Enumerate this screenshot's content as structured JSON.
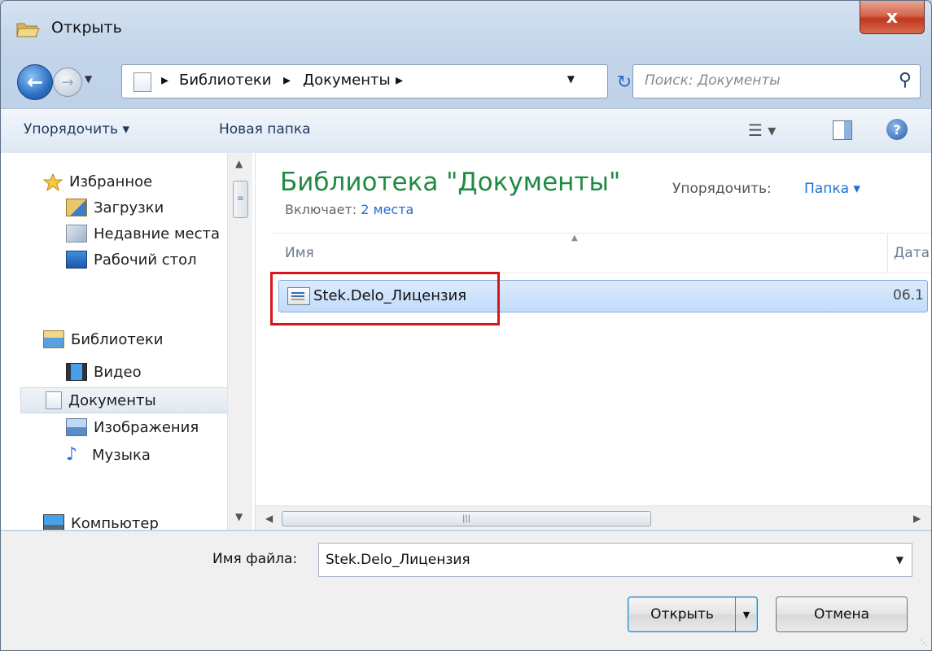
{
  "window": {
    "title": "Открыть",
    "close_label": "x"
  },
  "nav": {
    "breadcrumbs": [
      "Библиотеки",
      "Документы"
    ],
    "search_placeholder": "Поиск: Документы"
  },
  "toolbar": {
    "organize_label": "Упорядочить ▾",
    "new_folder_label": "Новая папка"
  },
  "sidebar": {
    "favorites": {
      "label": "Избранное",
      "items": [
        {
          "label": "Загрузки",
          "icon": "downloads-folder-icon"
        },
        {
          "label": "Недавние места",
          "icon": "recent-places-icon"
        },
        {
          "label": "Рабочий стол",
          "icon": "desktop-icon"
        }
      ]
    },
    "libraries": {
      "label": "Библиотеки",
      "items": [
        {
          "label": "Видео",
          "icon": "video-library-icon"
        },
        {
          "label": "Документы",
          "icon": "documents-library-icon",
          "selected": true
        },
        {
          "label": "Изображения",
          "icon": "pictures-library-icon"
        },
        {
          "label": "Музыка",
          "icon": "music-library-icon"
        }
      ]
    },
    "computer": {
      "label": "Компьютер"
    }
  },
  "main": {
    "library_title": "Библиотека \"Документы\"",
    "includes_label": "Включает:",
    "includes_link": "2 места",
    "arrange_label": "Упорядочить:",
    "arrange_value": "Папка ▾",
    "columns": {
      "name": "Имя",
      "date": "Дата"
    },
    "files": [
      {
        "name": "Stek.Delo_Лицензия",
        "date": "06.1"
      }
    ]
  },
  "footer": {
    "filename_label": "Имя файла:",
    "filename_value": "Stek.Delo_Лицензия",
    "open_label": "Открыть",
    "cancel_label": "Отмена"
  },
  "colors": {
    "accent_green": "#1f8a43",
    "link_blue": "#1f6fd1",
    "highlight_red": "#d5161c",
    "selection_blue": "#c1dcfb"
  }
}
